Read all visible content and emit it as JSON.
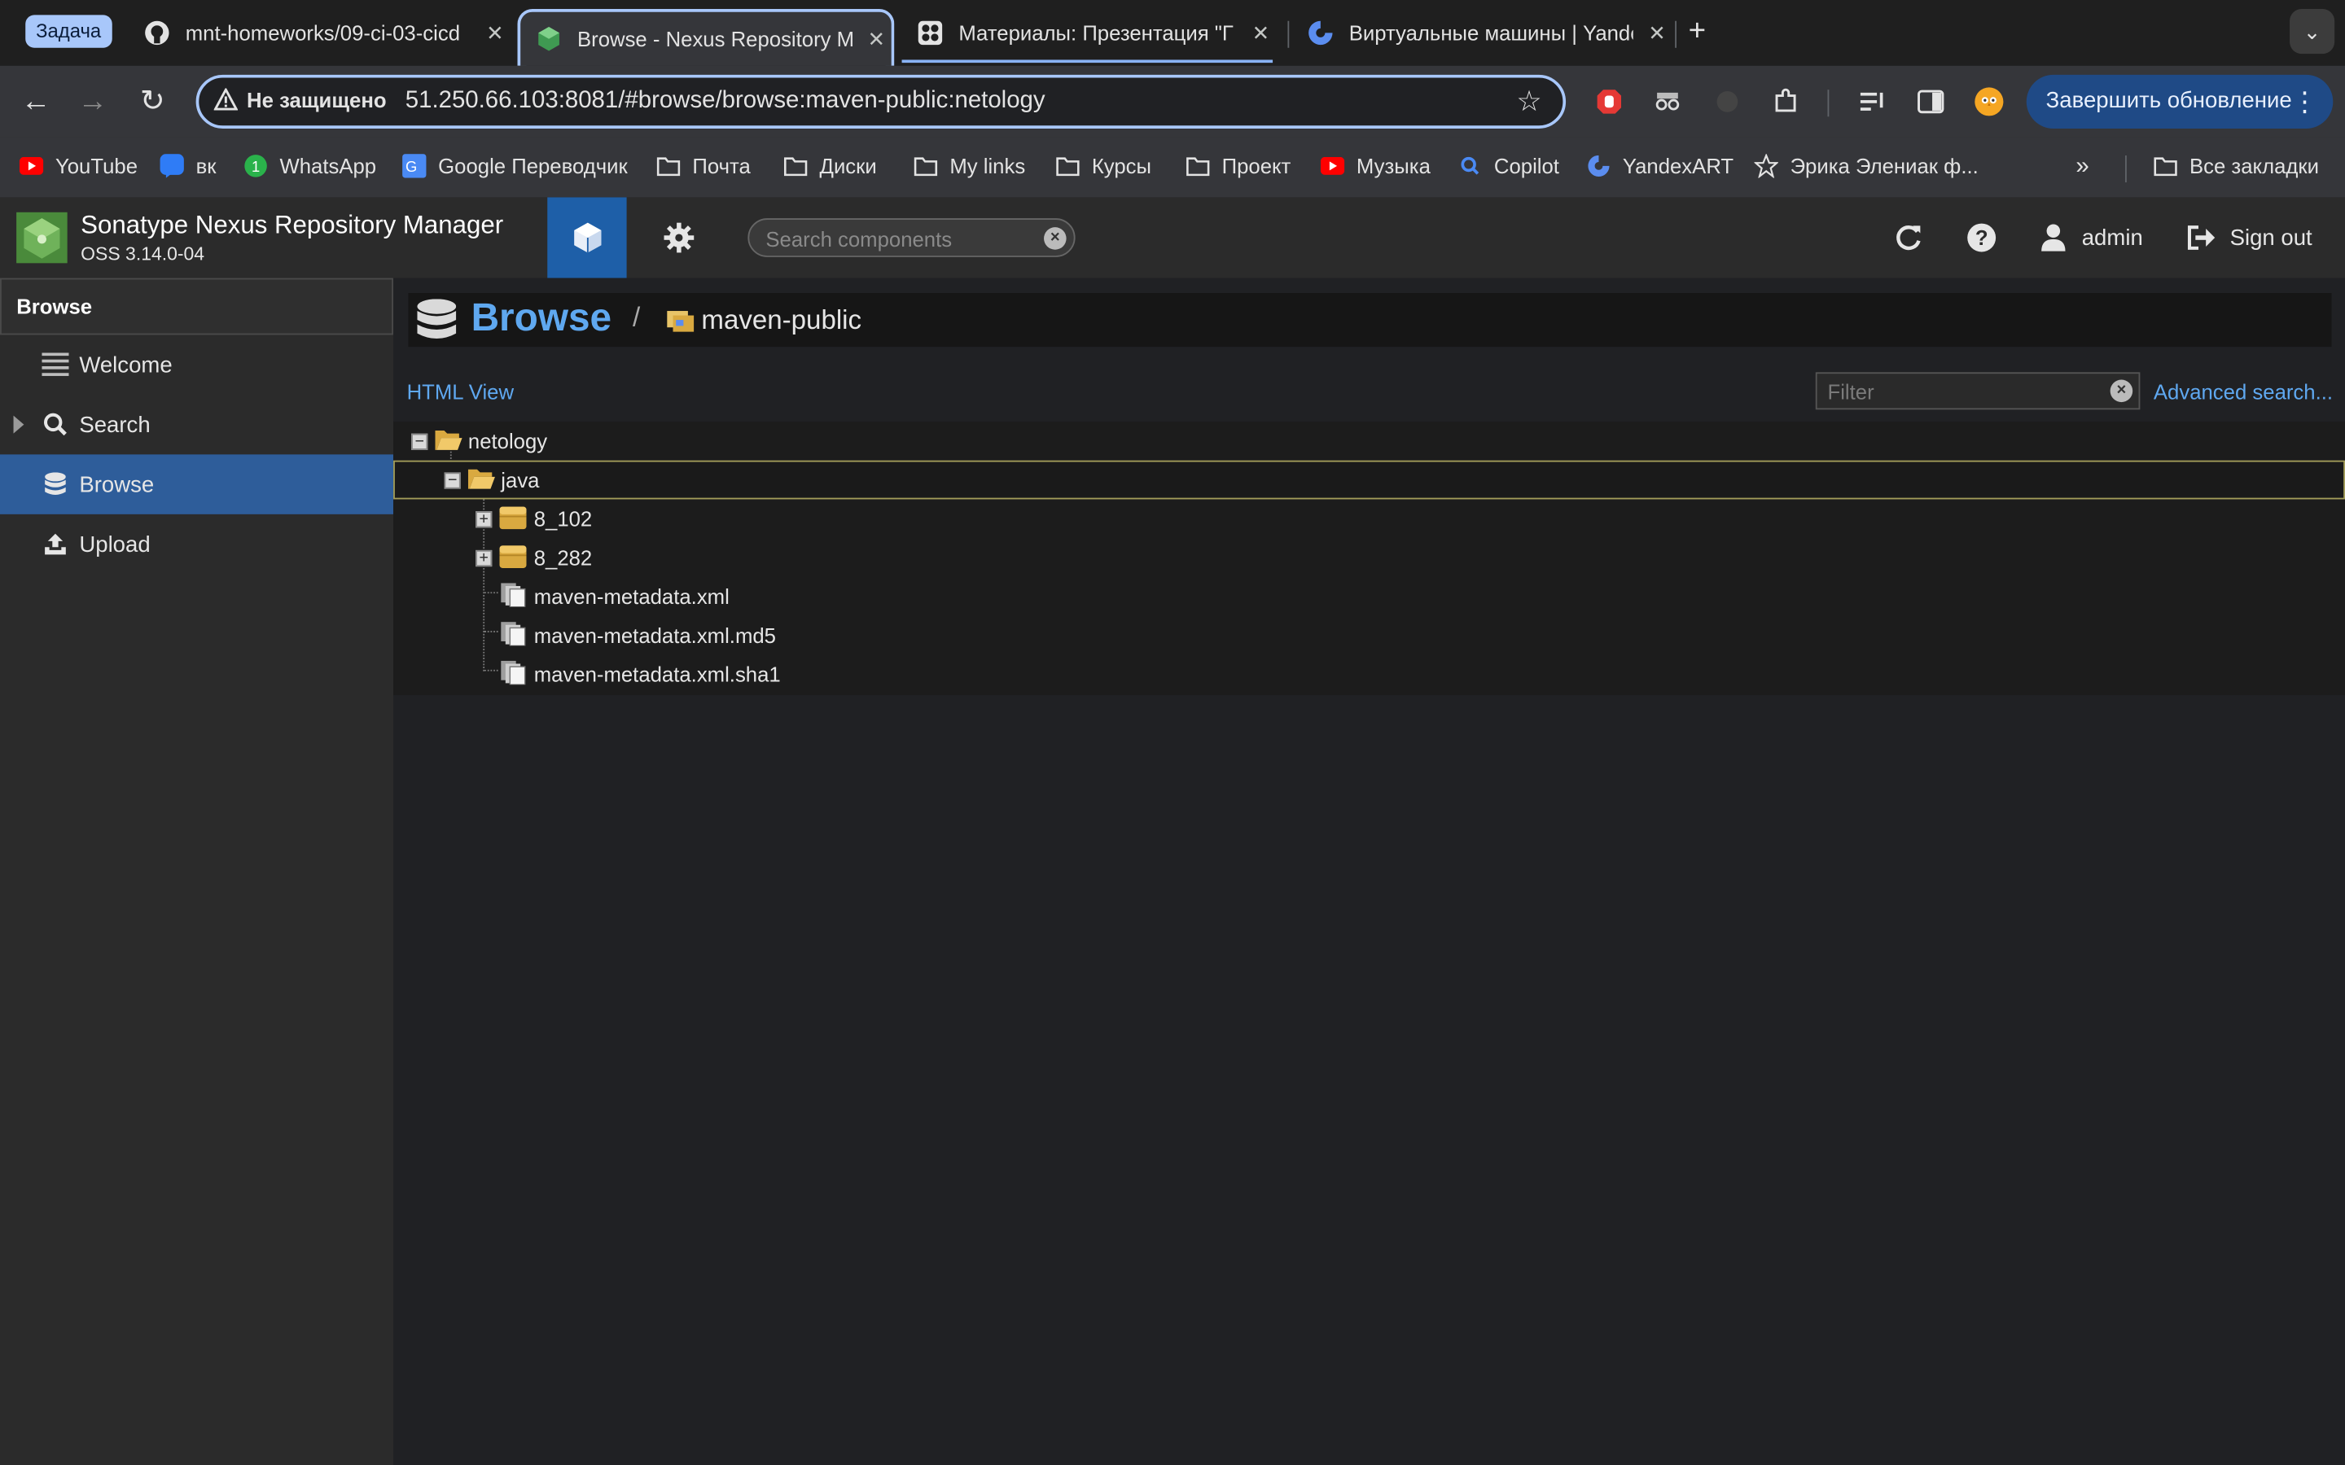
{
  "browser": {
    "task_chip": "Задача",
    "tabs": [
      {
        "title": "mnt-homeworks/09-ci-03-cicd",
        "favicon": "github-icon"
      },
      {
        "title": "Browse - Nexus Repository Manager",
        "favicon": "nexus-icon",
        "active": true
      },
      {
        "title": "Материалы: Презентация \"Г",
        "favicon": "netology-icon"
      },
      {
        "title": "Виртуальные машины | Yandex",
        "favicon": "yandex-cloud-icon"
      }
    ],
    "new_tab": "+",
    "address": {
      "security": "Не защищено",
      "url": "51.250.66.103:8081/#browse/browse:maven-public:netology"
    },
    "update_button": "Завершить обновление",
    "bookmarks": [
      "YouTube",
      "вк",
      "WhatsApp",
      "Google Переводчик",
      "Почта",
      "Диски",
      "My links",
      "Курсы",
      "Проект",
      "Музыка",
      "Copilot",
      "YandexART",
      "Эрика Элениак ф..."
    ],
    "all_bookmarks": "Все закладки"
  },
  "nexus": {
    "app_title": "Sonatype Nexus Repository Manager",
    "version": "OSS 3.14.0-04",
    "search_placeholder": "Search components",
    "user": "admin",
    "sign_out": "Sign out",
    "sidebar": {
      "header": "Browse",
      "items": [
        {
          "label": "Welcome",
          "icon": "welcome-icon"
        },
        {
          "label": "Search",
          "icon": "search-icon"
        },
        {
          "label": "Browse",
          "icon": "database-icon",
          "selected": true
        },
        {
          "label": "Upload",
          "icon": "upload-icon"
        }
      ]
    },
    "breadcrumb": {
      "title": "Browse",
      "separator": "/",
      "repository": "maven-public"
    },
    "html_view": "HTML View",
    "filter_placeholder": "Filter",
    "advanced_search": "Advanced search...",
    "tree": [
      {
        "label": "netology",
        "type": "folder-open",
        "depth": 0
      },
      {
        "label": "java",
        "type": "folder-open",
        "depth": 1,
        "selected": true
      },
      {
        "label": "8_102",
        "type": "component",
        "depth": 2
      },
      {
        "label": "8_282",
        "type": "component",
        "depth": 2
      },
      {
        "label": "maven-metadata.xml",
        "type": "asset",
        "depth": 2
      },
      {
        "label": "maven-metadata.xml.md5",
        "type": "asset",
        "depth": 2
      },
      {
        "label": "maven-metadata.xml.sha1",
        "type": "asset",
        "depth": 2
      }
    ]
  }
}
